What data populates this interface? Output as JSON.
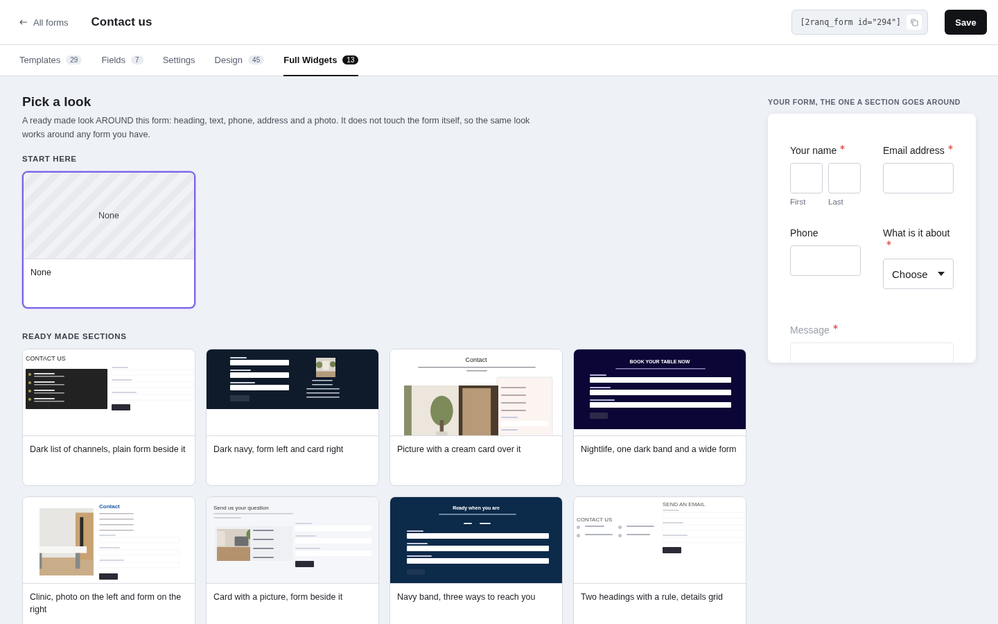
{
  "header": {
    "back_link": "All forms",
    "title": "Contact us",
    "shortcode": "[2ranq_form id=\"294\"]",
    "save_button": "Save"
  },
  "tabs": [
    {
      "label": "Templates",
      "count": "29",
      "selected": false
    },
    {
      "label": "Fields",
      "count": "7",
      "selected": false
    },
    {
      "label": "Settings",
      "selected": false
    },
    {
      "label": "Design",
      "count": "45",
      "selected": false
    },
    {
      "label": "Full Widgets",
      "count": "13",
      "selected": true
    }
  ],
  "intro": {
    "title": "Pick a look",
    "text": "A ready made look AROUND this form: heading, text, phone, address and a photo. It does not touch the form itself, so the same look works around any form you have."
  },
  "start_section": {
    "heading": "START HERE",
    "cards": [
      {
        "preview_text": "None",
        "label": "None",
        "selected": true
      }
    ]
  },
  "ready_section": {
    "heading": "READY MADE SECTIONS",
    "cards": [
      {
        "kind": "dark-list",
        "headings": [
          "CONTACT US"
        ],
        "label": "Dark list of channels, plain form beside it",
        "selected": false
      },
      {
        "kind": "navy-card",
        "label": "Dark navy, form left and card right",
        "selected": false
      },
      {
        "kind": "photo-cream",
        "headings": [
          "Contact"
        ],
        "label": "Picture with a cream card over it",
        "selected": false
      },
      {
        "kind": "nightlife",
        "headings": [
          "BOOK YOUR TABLE NOW"
        ],
        "label": "Nightlife, one dark band and a wide form",
        "selected": false
      },
      {
        "kind": "clinic",
        "headings": [
          "Contact"
        ],
        "label": "Clinic, photo on the left and form on the right",
        "selected": false
      },
      {
        "kind": "picture-card",
        "headings": [
          "Send us your question"
        ],
        "label": "Card with a picture, form beside it",
        "selected": false
      },
      {
        "kind": "navy-band",
        "headings": [
          "Ready when you are"
        ],
        "label": "Navy band, three ways to reach you",
        "selected": false
      },
      {
        "kind": "two-headings",
        "headings": [
          "SEND AN EMAIL",
          "CONTACT US"
        ],
        "label": "Two headings with a rule, details grid",
        "selected": false
      }
    ]
  },
  "form_preview": {
    "heading": "YOUR FORM, THE ONE A SECTION GOES AROUND",
    "fields": [
      {
        "kind": "name",
        "label": "Your name",
        "required": true,
        "sublabels": [
          "First",
          "Last"
        ],
        "faded": false
      },
      {
        "kind": "text",
        "label": "Email address",
        "required": true,
        "faded": false
      },
      {
        "kind": "text",
        "label": "Phone",
        "required": false,
        "faded": false
      },
      {
        "kind": "select",
        "label": "What is it about",
        "required": true,
        "value": "Choose",
        "faded": false
      },
      {
        "kind": "textarea",
        "label": "Message",
        "required": true,
        "faded": true
      }
    ]
  }
}
